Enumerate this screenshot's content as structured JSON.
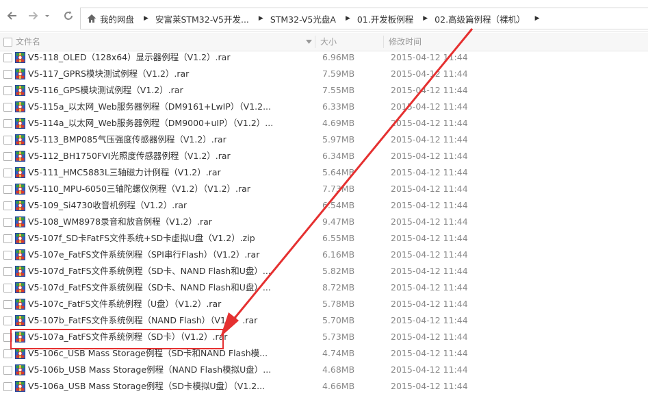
{
  "nav": {
    "back_icon": "arrow-left-icon",
    "forward_icon": "arrow-right-icon",
    "refresh_icon": "refresh-icon"
  },
  "breadcrumb": [
    {
      "label": "我的网盘"
    },
    {
      "label": "安富莱STM32-V5开发..."
    },
    {
      "label": "STM32-V5光盘A"
    },
    {
      "label": "01.开发板例程"
    },
    {
      "label": "02.高级篇例程（裸机）"
    }
  ],
  "columns": {
    "name": "文件名",
    "size": "大小",
    "modified": "修改时间"
  },
  "files": [
    {
      "name": "V5-118_OLED（128x64）显示器例程（V1.2）.rar",
      "size": "6.96MB",
      "date": "2015-04-12 11:44"
    },
    {
      "name": "V5-117_GPRS模块测试例程（V1.2）.rar",
      "size": "7.59MB",
      "date": "2015-04-12 11:44"
    },
    {
      "name": "V5-116_GPS模块测试例程（V1.2）.rar",
      "size": "7.55MB",
      "date": "2015-04-12 11:44"
    },
    {
      "name": "V5-115a_以太网_Web服务器例程（DM9161+LwIP）（V1.2...",
      "size": "6.33MB",
      "date": "2015-04-12 11:44"
    },
    {
      "name": "V5-114a_以太网_Web服务器例程（DM9000+uIP）（V1.2）...",
      "size": "4.69MB",
      "date": "2015-04-12 11:44"
    },
    {
      "name": "V5-113_BMP085气压强度传感器例程（V1.2）.rar",
      "size": "5.97MB",
      "date": "2015-04-12 11:44"
    },
    {
      "name": "V5-112_BH1750FVI光照度传感器例程（V1.2）.rar",
      "size": "6.34MB",
      "date": "2015-04-12 11:44"
    },
    {
      "name": "V5-111_HMC5883L三轴磁力计例程（V1.2）.rar",
      "size": "5.64MB",
      "date": "2015-04-12 11:44"
    },
    {
      "name": "V5-110_MPU-6050三轴陀螺仪例程（V1.2）（V1.2）.rar",
      "size": "7.73MB",
      "date": "2015-04-12 11:44"
    },
    {
      "name": "V5-109_Si4730收音机例程（V1.2）.rar",
      "size": "6.54MB",
      "date": "2015-04-12 11:44"
    },
    {
      "name": "V5-108_WM8978录音和放音例程（V1.2）.rar",
      "size": "9.47MB",
      "date": "2015-04-12 11:44"
    },
    {
      "name": "V5-107f_SD卡FatFS文件系统+SD卡虚拟U盘（V1.2）.zip",
      "size": "6.55MB",
      "date": "2015-04-12 11:44"
    },
    {
      "name": "V5-107e_FatFS文件系统例程（SPI串行Flash）（V1.2）.rar",
      "size": "6.16MB",
      "date": "2015-04-12 11:44"
    },
    {
      "name": "V5-107d_FatFS文件系统例程（SD卡、NAND Flash和U盘）...",
      "size": "5.82MB",
      "date": "2015-04-12 11:44"
    },
    {
      "name": "V5-107d_FatFS文件系统例程（SD卡、NAND Flash和U盘）...",
      "size": "8.72MB",
      "date": "2015-04-12 11:44"
    },
    {
      "name": "V5-107c_FatFS文件系统例程（U盘）（V1.2）.rar",
      "size": "5.78MB",
      "date": "2015-04-12 11:44"
    },
    {
      "name": "V5-107b_FatFS文件系统例程（NAND Flash）（V1.2）.rar",
      "size": "5.70MB",
      "date": "2015-04-12 11:44"
    },
    {
      "name": "V5-107a_FatFS文件系统例程（SD卡）（V1.2）.rar",
      "size": "5.73MB",
      "date": "2015-04-12 11:44"
    },
    {
      "name": "V5-106c_USB Mass Storage例程（SD卡和NAND Flash模...",
      "size": "4.74MB",
      "date": "2015-04-12 11:44"
    },
    {
      "name": "V5-106b_USB Mass Storage例程（NAND Flash模拟U盘）...",
      "size": "4.68MB",
      "date": "2015-04-12 11:44"
    },
    {
      "name": "V5-106a_USB Mass Storage例程（SD卡模拟U盘）（V1.2...",
      "size": "4.66MB",
      "date": "2015-04-12 11:44"
    }
  ],
  "colors": {
    "annotation": "#e53030",
    "icon_green": "#3c9a3c",
    "icon_red": "#d93a2b",
    "icon_blue": "#2f5fc0"
  }
}
